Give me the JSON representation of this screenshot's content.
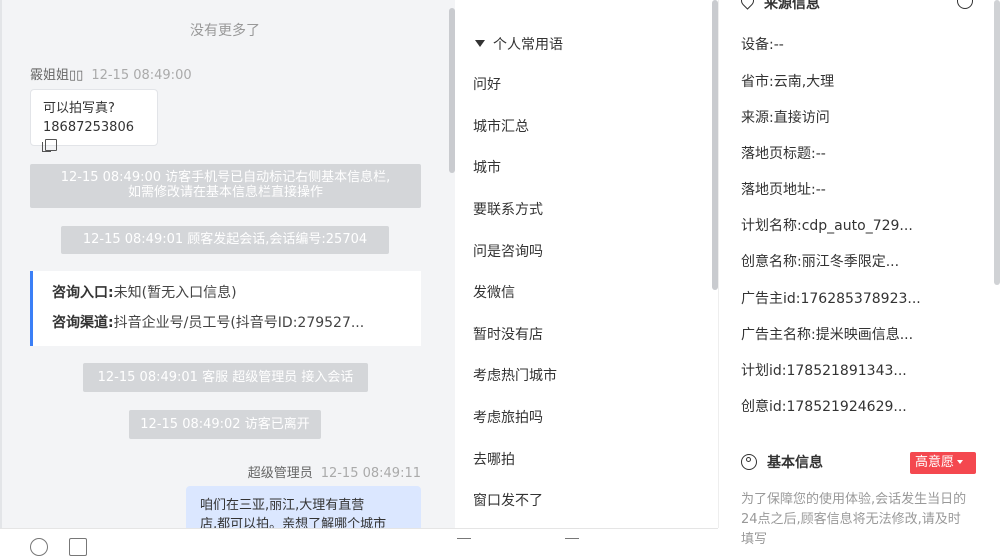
{
  "chat": {
    "no_more": "没有更多了",
    "visitor": {
      "name": "霰姐姐▯▯",
      "time": "12-15 08:49:00"
    },
    "visitor_message": {
      "line1": "可以拍写真?",
      "line2": "18687253806"
    },
    "system_phone_notice": {
      "line1": "12-15 08:49:00 访客手机号已自动标记右侧基本信息栏,",
      "line2": "如需修改请在基本信息栏直接操作"
    },
    "system_session_start": "12-15 08:49:01 顾客发起会话,会话编号:25704",
    "consult_card": {
      "entry_label": "咨询入口:",
      "entry_value": "未知(暂无入口信息)",
      "channel_label": "咨询渠道:",
      "channel_value": "抖音企业号/员工号(抖音号ID:279527..."
    },
    "system_agent_join": "12-15 08:49:01 客服 超级管理员 接入会话",
    "system_visitor_left": "12-15 08:49:02 访客已离开",
    "agent": {
      "name": "超级管理员",
      "time": "12-15 08:49:11"
    },
    "agent_message": {
      "line1": "咱们在三亚,丽江,大理有直营",
      "line2": "店,都可以拍。亲想了解哪个城市"
    }
  },
  "phrases": {
    "title": "个人常用语",
    "items": [
      "问好",
      "城市汇总",
      "城市",
      "要联系方式",
      "问是咨询吗",
      "发微信",
      "暂时没有店",
      "考虑热门城市",
      "考虑旅拍吗",
      "去哪拍",
      "窗口发不了"
    ]
  },
  "source_info": {
    "title": "来源信息",
    "rows": [
      "设备:--",
      "省市:云南,大理",
      "来源:直接访问",
      "落地页标题:--",
      "落地页地址:--",
      "计划名称:cdp_auto_729...",
      "创意名称:丽江冬季限定...",
      "广告主id:176285378923...",
      "广告主名称:提米映画信息...",
      "计划id:178521891343...",
      "创意id:178521924629..."
    ]
  },
  "basic_info": {
    "title": "基本信息",
    "intent_badge": "高意愿",
    "note": "为了保障您的使用体验,会话发生当日的24点之后,顾客信息将无法修改,请及时填写"
  }
}
